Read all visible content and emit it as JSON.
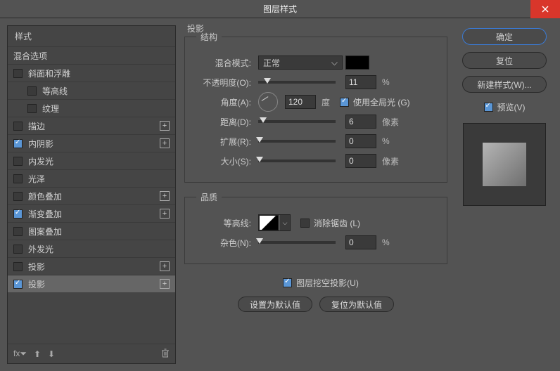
{
  "window": {
    "title": "图层样式"
  },
  "left": {
    "header": "样式",
    "blend_options": "混合选项",
    "items": [
      {
        "label": "斜面和浮雕",
        "checked": false,
        "plus": false
      },
      {
        "label": "等高线",
        "checked": false,
        "plus": false,
        "sub": true
      },
      {
        "label": "纹理",
        "checked": false,
        "plus": false,
        "sub": true
      },
      {
        "label": "描边",
        "checked": false,
        "plus": true
      },
      {
        "label": "内阴影",
        "checked": true,
        "plus": true
      },
      {
        "label": "内发光",
        "checked": false,
        "plus": false
      },
      {
        "label": "光泽",
        "checked": false,
        "plus": false
      },
      {
        "label": "颜色叠加",
        "checked": false,
        "plus": true
      },
      {
        "label": "渐变叠加",
        "checked": true,
        "plus": true
      },
      {
        "label": "图案叠加",
        "checked": false,
        "plus": false
      },
      {
        "label": "外发光",
        "checked": false,
        "plus": false
      },
      {
        "label": "投影",
        "checked": false,
        "plus": true
      },
      {
        "label": "投影",
        "checked": true,
        "plus": true,
        "selected": true
      }
    ]
  },
  "panel": {
    "title": "投影",
    "structure": {
      "legend": "结构",
      "blend_mode_label": "混合模式:",
      "blend_mode_value": "正常",
      "opacity_label": "不透明度(O):",
      "opacity_value": "11",
      "opacity_unit": "%",
      "angle_label": "角度(A):",
      "angle_value": "120",
      "angle_unit": "度",
      "global_light_label": "使用全局光 (G)",
      "global_light_checked": true,
      "distance_label": "距离(D):",
      "distance_value": "6",
      "distance_unit": "像素",
      "spread_label": "扩展(R):",
      "spread_value": "0",
      "spread_unit": "%",
      "size_label": "大小(S):",
      "size_value": "0",
      "size_unit": "像素"
    },
    "quality": {
      "legend": "品质",
      "contour_label": "等高线:",
      "antialias_label": "消除锯齿 (L)",
      "antialias_checked": false,
      "noise_label": "杂色(N):",
      "noise_value": "0",
      "noise_unit": "%"
    },
    "knockout_label": "图层挖空投影(U)",
    "knockout_checked": true,
    "btn_default": "设置为默认值",
    "btn_reset": "复位为默认值"
  },
  "right": {
    "ok": "确定",
    "cancel": "复位",
    "new_style": "新建样式(W)...",
    "preview_label": "预览(V)",
    "preview_checked": true
  }
}
